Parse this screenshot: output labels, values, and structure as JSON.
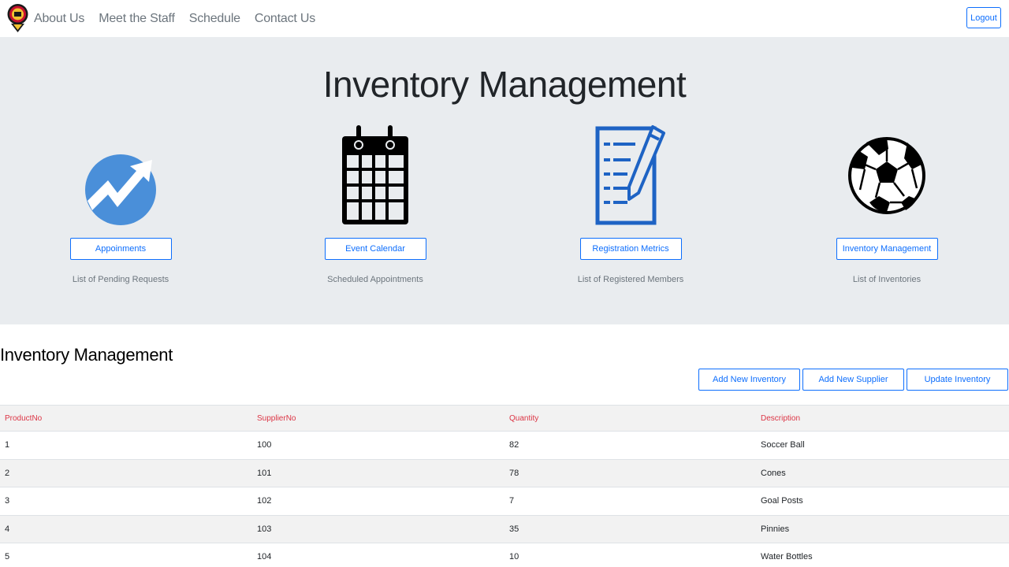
{
  "navbar": {
    "links": [
      "About Us",
      "Meet the Staff",
      "Schedule",
      "Contact Us"
    ],
    "logout_label": "Logout"
  },
  "hero": {
    "title": "Inventory Management",
    "cards": [
      {
        "icon": "trending-up-icon",
        "button": "Appoinments",
        "description": "List of Pending Requests",
        "color": "#4a8fd9"
      },
      {
        "icon": "calendar-icon",
        "button": "Event Calendar",
        "description": "Scheduled Appointments",
        "color": "#000000"
      },
      {
        "icon": "clipboard-edit-icon",
        "button": "Registration Metrics",
        "description": "List of Registered Members",
        "color": "#1e63c4"
      },
      {
        "icon": "soccer-ball-icon",
        "button": "Inventory Management",
        "description": "List of Inventories",
        "color": "#000000"
      }
    ]
  },
  "section": {
    "title": "Inventory Management",
    "actions": [
      "Add New Inventory",
      "Add New Supplier",
      "Update Inventory"
    ]
  },
  "table": {
    "headers": [
      "ProductNo",
      "SupplierNo",
      "Quantity",
      "Description"
    ],
    "rows": [
      [
        "1",
        "100",
        "82",
        "Soccer Ball"
      ],
      [
        "2",
        "101",
        "78",
        "Cones"
      ],
      [
        "3",
        "102",
        "7",
        "Goal Posts"
      ],
      [
        "4",
        "103",
        "35",
        "Pinnies"
      ],
      [
        "5",
        "104",
        "10",
        "Water Bottles"
      ]
    ]
  },
  "colors": {
    "accent": "#0d6efd",
    "hero_bg": "#e9ecef",
    "header_text": "#dc3545"
  }
}
